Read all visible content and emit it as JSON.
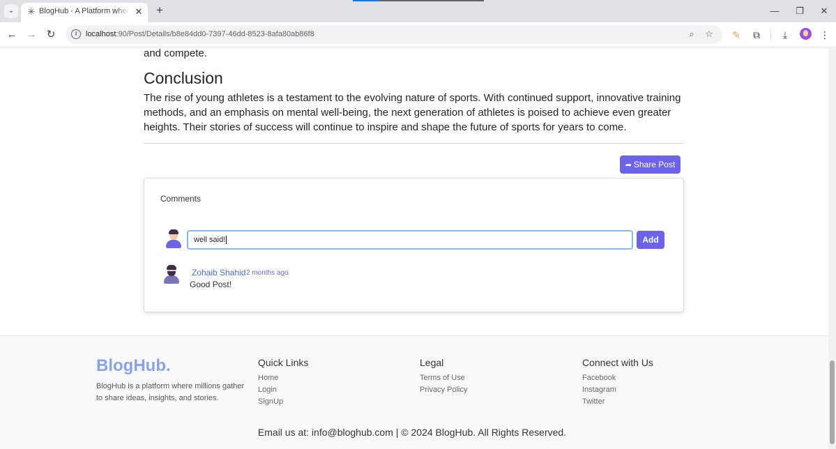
{
  "browser": {
    "tab_title": "BlogHub - A Platform where yo",
    "url_host": "localhost",
    "url_rest": ":90/Post/Details/b8e84dd0-7397-46dd-8523-8afa80ab86f8"
  },
  "article": {
    "tail_text": "and compete.",
    "heading": "Conclusion",
    "paragraph": "The rise of young athletes is a testament to the evolving nature of sports. With continued support, innovative training methods, and an emphasis on mental well-being, the next generation of athletes is poised to achieve even greater heights. Their stories of success will continue to inspire and shape the future of sports for years to come."
  },
  "share_button_label": "Share Post",
  "comments": {
    "title": "Comments",
    "input_value": "well said!",
    "add_label": "Add",
    "items": [
      {
        "author": "Zohaib Shahid",
        "time": "2 months ago",
        "text": "Good Post!"
      }
    ]
  },
  "footer": {
    "brand": "BlogHub.",
    "description": "BlogHub is a platform where millions gather to share ideas, insights, and stories.",
    "quick_links": {
      "title": "Quick Links",
      "links": [
        "Home",
        "Login",
        "SignUp"
      ]
    },
    "legal": {
      "title": "Legal",
      "links": [
        "Terms of Use",
        "Privacy Policy"
      ]
    },
    "connect": {
      "title": "Connect with Us",
      "links": [
        "Facebook",
        "Instagram",
        "Twitter"
      ]
    },
    "copyright": "Email us at: info@bloghub.com |  © 2024 BlogHub. All Rights Reserved."
  },
  "colors": {
    "accent": "#6c63e8",
    "brand": "#8aa3e6",
    "link": "#4a6fd8"
  }
}
